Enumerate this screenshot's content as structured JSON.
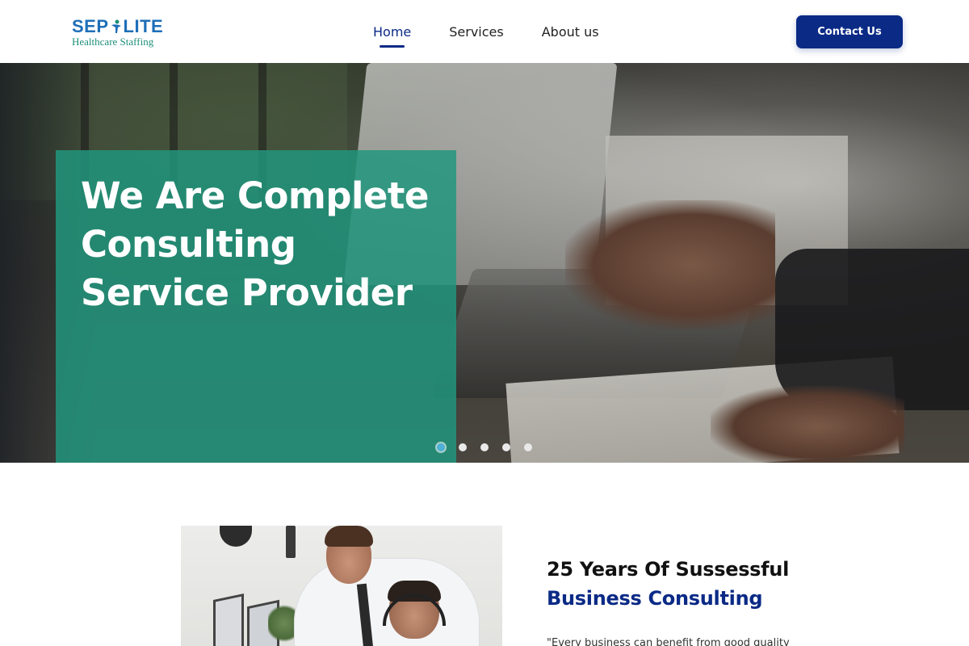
{
  "brand": {
    "logo_main_left": "SEP",
    "logo_main_right": "LITE",
    "logo_sub": "Healthcare Staffing",
    "primary_color": "#0a2a86",
    "logo_color": "#1e6fb8",
    "accent_color": "#1e8f7a"
  },
  "nav": {
    "items": [
      {
        "label": "Home",
        "active": true
      },
      {
        "label": "Services",
        "active": false
      },
      {
        "label": "About us",
        "active": false
      }
    ],
    "cta_label": "Contact Us"
  },
  "hero": {
    "title_line1": "We Are Complete",
    "title_line2": "Consulting",
    "title_line3": "Service Provider",
    "panel_color": "#20967d",
    "slides_count": 5,
    "active_slide": 1
  },
  "about": {
    "heading_line1": "25 Years Of Sussessful",
    "heading_line2": "Business Consulting",
    "quote_start": "\"Every business can benefit from good quality"
  }
}
